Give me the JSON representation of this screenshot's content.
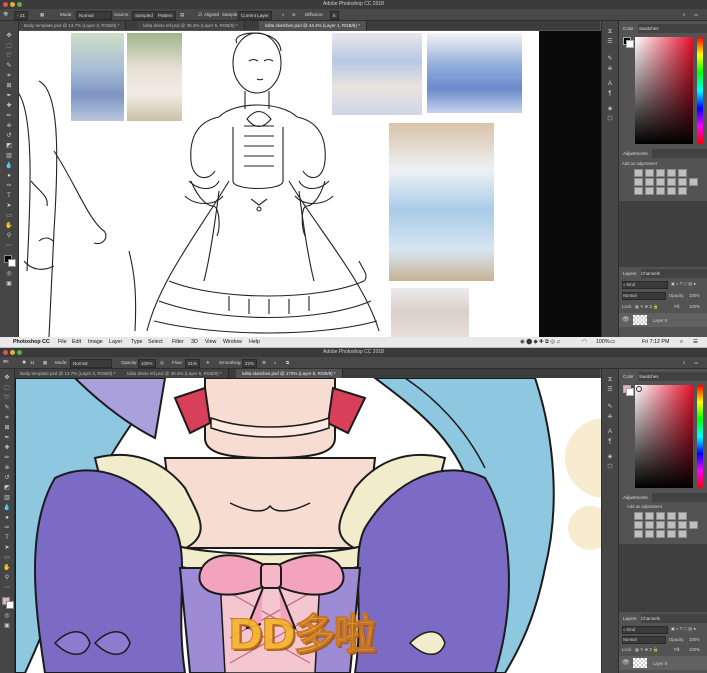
{
  "top_window": {
    "title": "Adobe Photoshop CC 2018",
    "options": {
      "mode_label": "Mode:",
      "mode_value": "Normal",
      "source_label": "Source:",
      "source_sampled": "Sampled",
      "source_pattern": "Pattern",
      "aligned": "Aligned",
      "sample_label": "Sample:",
      "sample_value": "Current Layer",
      "diffusion_label": "Diffusion:",
      "diffusion_value": "5"
    },
    "tabs": [
      "Body template.psd @ 13.7% (Layer 3, RGB/8) *",
      "lolita dress ref.psd @ 36.3% (Layer 5, RGB/8) *",
      "lolita sketches.psd @ 44.4% (Layer 1, RGB/8) *"
    ],
    "right_panels": {
      "color_tab": "Color",
      "swatches_tab": "Swatches",
      "adjustments_title": "Adjustments",
      "adjustments_hint": "Add an adjustment",
      "layers_tab": "Layers",
      "channels_tab": "Channels",
      "kind_filter": "Kind",
      "blend_mode": "Normal",
      "opacity_label": "Opacity:",
      "opacity_value": "100%",
      "lock_label": "Lock:",
      "fill_label": "Fill:",
      "fill_value": "100%",
      "layer_name": "Layer 6"
    }
  },
  "menubar": {
    "apple": "",
    "items": [
      "Photoshop CC",
      "File",
      "Edit",
      "Image",
      "Layer",
      "Type",
      "Select",
      "Filter",
      "3D",
      "View",
      "Window",
      "Help"
    ],
    "battery": "100%",
    "clock": "Fri 7:12 PM"
  },
  "bottom_window": {
    "title": "Adobe Photoshop CC 2018",
    "options": {
      "brush_size": "11",
      "mode_label": "Mode:",
      "mode_value": "Normal",
      "opacity_label": "Opacity:",
      "opacity_value": "100%",
      "flow_label": "Flow:",
      "flow_value": "51%",
      "smoothing_label": "Smoothing:",
      "smoothing_value": "22%"
    },
    "tabs": [
      "Body template.psd @ 13.7% (Layer 3, RGB/8) *",
      "lolita dress ref.psd @ 36.3% (Layer 5, RGB/8) *",
      "lolita sketches.psd @ 170% (Layer 8, RGB/8) *"
    ],
    "right_panels": {
      "color_tab": "Color",
      "swatches_tab": "Swatches",
      "adjustments_title": "Adjustments",
      "adjustments_hint": "Add an adjustment",
      "layers_tab": "Layers",
      "channels_tab": "Channels",
      "kind_filter": "Kind",
      "blend_mode": "Normal",
      "opacity_label": "Opacity:",
      "opacity_value": "100%",
      "lock_label": "Lock:",
      "fill_label": "Fill:",
      "fill_value": "100%",
      "layer_name": "Layer 8"
    }
  },
  "watermark_text": "DD多啦",
  "colors": {
    "dress_purple": "#7b6bc4",
    "hair_blue": "#8ec7e0",
    "bow_pink": "#f4a3bf",
    "skin": "#f7dcd2",
    "cream_frill": "#f1eccb",
    "collar_red": "#d8405a",
    "watermark_orange": "#f3b52c"
  }
}
